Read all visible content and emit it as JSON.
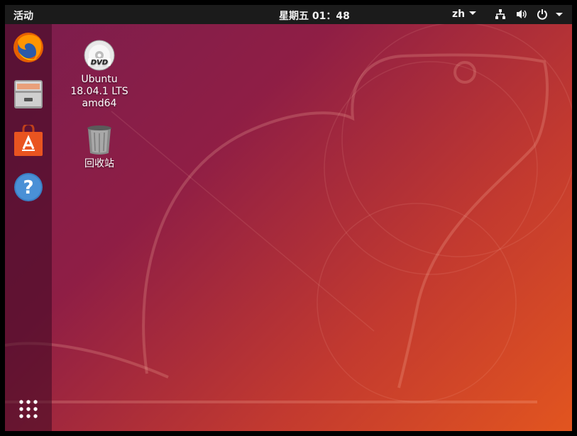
{
  "topbar": {
    "activities_label": "活动",
    "clock": "星期五 01：48",
    "input_method": "zh"
  },
  "dock": {
    "items": [
      {
        "name": "firefox",
        "icon": "firefox-icon"
      },
      {
        "name": "files",
        "icon": "file-cabinet-icon"
      },
      {
        "name": "software",
        "icon": "shopping-bag-icon"
      },
      {
        "name": "help",
        "icon": "help-icon"
      },
      {
        "name": "show-applications",
        "icon": "app-grid-icon"
      }
    ]
  },
  "desktop": {
    "icons": [
      {
        "label": "Ubuntu\n18.04.1 LTS\namd64",
        "icon": "dvd-icon"
      },
      {
        "label": "回收站",
        "icon": "trash-icon"
      }
    ]
  },
  "colors": {
    "panel": "#1b1b1b",
    "wallpaper_start": "#7a1d4e",
    "wallpaper_end": "#e2551f"
  }
}
